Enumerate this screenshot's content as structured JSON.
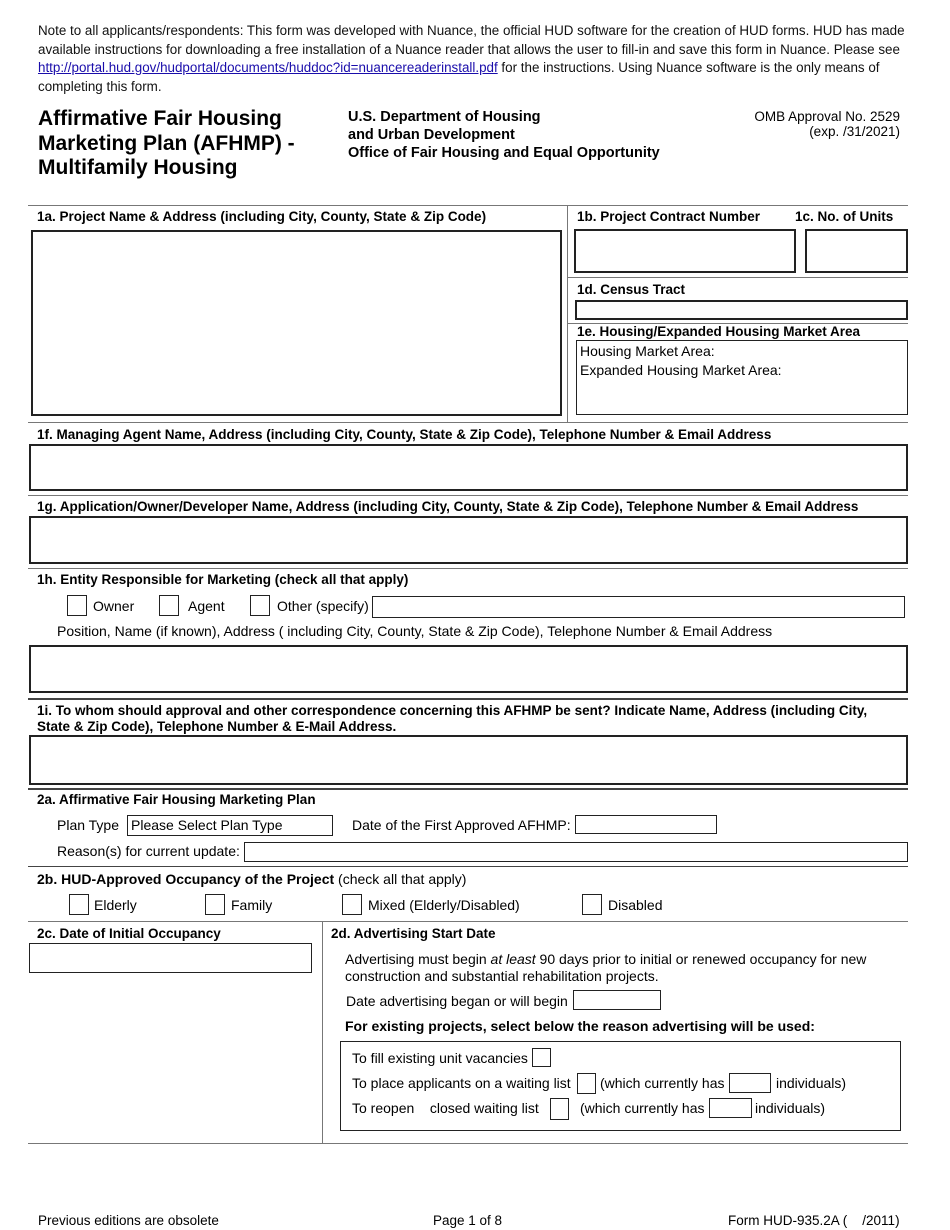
{
  "notice": {
    "text_before_link": "Note to all applicants/respondents: This form was developed with Nuance, the official HUD software for the creation of HUD forms. HUD has made available instructions for downloading a free installation of a Nuance reader that allows the user to fill-in and save this form in Nuance. Please see ",
    "link_text": "http://portal.hud.gov/hudportal/documents/huddoc?id=nuancereaderinstall.pdf",
    "text_after_link": " for the instructions. Using Nuance software is the only means of completing this form."
  },
  "header": {
    "title_line1": "Affirmative Fair Housing",
    "title_line2": "Marketing Plan (AFHMP) -",
    "title_line3": "Multifamily Housing",
    "dept_line1": "U.S. Department of Housing",
    "dept_line2": "and Urban Development",
    "dept_line3": "Office of Fair Housing and Equal Opportunity",
    "omb_line1": "OMB Approval No. 2529",
    "omb_line2": "(exp.  /31/2021)"
  },
  "section1": {
    "a_label": "1a. Project Name & Address (including City, County, State & Zip Code)",
    "a_value": "",
    "b_label": "1b. Project Contract Number",
    "b_value": "",
    "c_label": "1c. No. of Units",
    "c_value": "",
    "d_label": "1d. Census Tract",
    "d_value": "",
    "e_label": "1e. Housing/Expanded Housing Market Area",
    "e_line1": "Housing Market Area:",
    "e_line2": "Expanded Housing Market Area:",
    "f_label": "1f. Managing Agent Name, Address (including City, County, State & Zip Code), Telephone Number & Email Address",
    "f_value": "",
    "g_label": "1g. Application/Owner/Developer Name, Address  (including City, County, State & Zip Code), Telephone Number & Email Address",
    "g_value": "",
    "h_label": "1h. Entity Responsible for Marketing (check all that apply)",
    "h_options": [
      "Owner",
      "Agent",
      "Other (specify)"
    ],
    "h_other_value": "",
    "h_position_label": "Position, Name (if known), Address ( including City, County, State & Zip Code), Telephone Number & Email Address",
    "h_position_value": "",
    "i_label_line1": "1i. To whom should approval and other correspondence concerning this AFHMP be sent? Indicate Name, Address (including City,",
    "i_label_line2": "State & Zip Code), Telephone Number & E-Mail Address.",
    "i_value": ""
  },
  "section2": {
    "a_label": "2a. Affirmative Fair Housing Marketing Plan",
    "plan_type_label": "Plan Type",
    "plan_type_value": "Please Select Plan Type",
    "first_approved_label": "Date of the First Approved AFHMP:",
    "first_approved_value": "",
    "reason_label": "Reason(s) for current update:",
    "reason_value": "",
    "b_label_bold": "2b. HUD-Approved Occupancy of the Project",
    "b_label_normal": " (check all that apply)",
    "b_options": [
      "Elderly",
      "Family",
      "Mixed (Elderly/Disabled)",
      "Disabled"
    ],
    "c_label": "2c. Date of Initial Occupancy",
    "c_value": "",
    "d_label": "2d.  Advertising Start Date",
    "d_note_before": "Advertising must begin ",
    "d_note_italic": "at least",
    "d_note_after_line1": " 90 days prior to initial or renewed occupancy for new",
    "d_note_line2": "construction and substantial rehabilitation projects.",
    "d_date_label": "Date advertising began or will begin",
    "d_date_value": "",
    "d_existing_label": "For existing projects, select below the reason advertising will be used:",
    "reason_fill": "To fill existing unit vacancies",
    "reason_place": "To place applicants on a waiting list",
    "reason_place_count_prefix": "(which currently has",
    "reason_place_count_suffix": "individuals)",
    "reason_place_count_value": "",
    "reason_reopen": "To reopen    closed waiting list",
    "reason_reopen_count_prefix": "(which currently has",
    "reason_reopen_count_suffix": "individuals)",
    "reason_reopen_count_value": ""
  },
  "footer": {
    "left": "Previous editions are obsolete",
    "center": "Page 1 of 8",
    "right": "Form HUD-935.2A (    /2011)"
  }
}
